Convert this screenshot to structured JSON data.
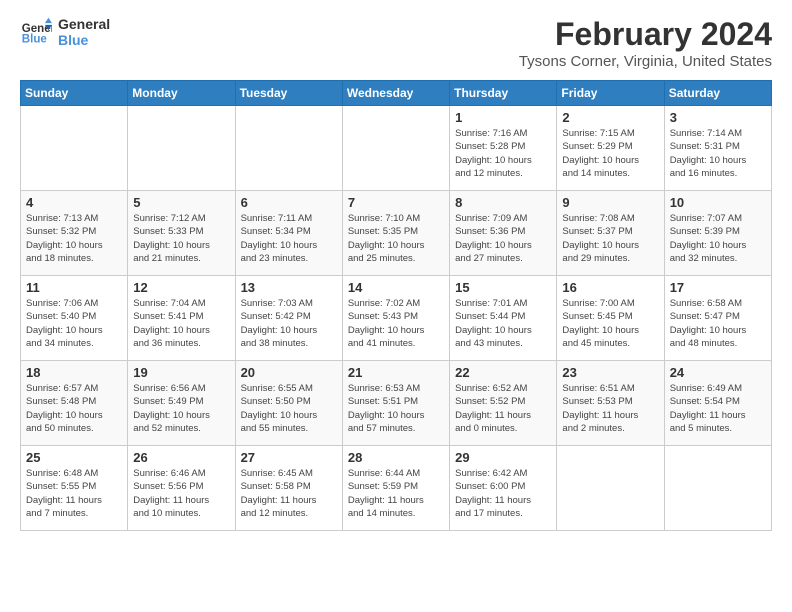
{
  "header": {
    "logo_line1": "General",
    "logo_line2": "Blue",
    "main_title": "February 2024",
    "subtitle": "Tysons Corner, Virginia, United States"
  },
  "weekdays": [
    "Sunday",
    "Monday",
    "Tuesday",
    "Wednesday",
    "Thursday",
    "Friday",
    "Saturday"
  ],
  "weeks": [
    [
      {
        "day": "",
        "info": ""
      },
      {
        "day": "",
        "info": ""
      },
      {
        "day": "",
        "info": ""
      },
      {
        "day": "",
        "info": ""
      },
      {
        "day": "1",
        "info": "Sunrise: 7:16 AM\nSunset: 5:28 PM\nDaylight: 10 hours\nand 12 minutes."
      },
      {
        "day": "2",
        "info": "Sunrise: 7:15 AM\nSunset: 5:29 PM\nDaylight: 10 hours\nand 14 minutes."
      },
      {
        "day": "3",
        "info": "Sunrise: 7:14 AM\nSunset: 5:31 PM\nDaylight: 10 hours\nand 16 minutes."
      }
    ],
    [
      {
        "day": "4",
        "info": "Sunrise: 7:13 AM\nSunset: 5:32 PM\nDaylight: 10 hours\nand 18 minutes."
      },
      {
        "day": "5",
        "info": "Sunrise: 7:12 AM\nSunset: 5:33 PM\nDaylight: 10 hours\nand 21 minutes."
      },
      {
        "day": "6",
        "info": "Sunrise: 7:11 AM\nSunset: 5:34 PM\nDaylight: 10 hours\nand 23 minutes."
      },
      {
        "day": "7",
        "info": "Sunrise: 7:10 AM\nSunset: 5:35 PM\nDaylight: 10 hours\nand 25 minutes."
      },
      {
        "day": "8",
        "info": "Sunrise: 7:09 AM\nSunset: 5:36 PM\nDaylight: 10 hours\nand 27 minutes."
      },
      {
        "day": "9",
        "info": "Sunrise: 7:08 AM\nSunset: 5:37 PM\nDaylight: 10 hours\nand 29 minutes."
      },
      {
        "day": "10",
        "info": "Sunrise: 7:07 AM\nSunset: 5:39 PM\nDaylight: 10 hours\nand 32 minutes."
      }
    ],
    [
      {
        "day": "11",
        "info": "Sunrise: 7:06 AM\nSunset: 5:40 PM\nDaylight: 10 hours\nand 34 minutes."
      },
      {
        "day": "12",
        "info": "Sunrise: 7:04 AM\nSunset: 5:41 PM\nDaylight: 10 hours\nand 36 minutes."
      },
      {
        "day": "13",
        "info": "Sunrise: 7:03 AM\nSunset: 5:42 PM\nDaylight: 10 hours\nand 38 minutes."
      },
      {
        "day": "14",
        "info": "Sunrise: 7:02 AM\nSunset: 5:43 PM\nDaylight: 10 hours\nand 41 minutes."
      },
      {
        "day": "15",
        "info": "Sunrise: 7:01 AM\nSunset: 5:44 PM\nDaylight: 10 hours\nand 43 minutes."
      },
      {
        "day": "16",
        "info": "Sunrise: 7:00 AM\nSunset: 5:45 PM\nDaylight: 10 hours\nand 45 minutes."
      },
      {
        "day": "17",
        "info": "Sunrise: 6:58 AM\nSunset: 5:47 PM\nDaylight: 10 hours\nand 48 minutes."
      }
    ],
    [
      {
        "day": "18",
        "info": "Sunrise: 6:57 AM\nSunset: 5:48 PM\nDaylight: 10 hours\nand 50 minutes."
      },
      {
        "day": "19",
        "info": "Sunrise: 6:56 AM\nSunset: 5:49 PM\nDaylight: 10 hours\nand 52 minutes."
      },
      {
        "day": "20",
        "info": "Sunrise: 6:55 AM\nSunset: 5:50 PM\nDaylight: 10 hours\nand 55 minutes."
      },
      {
        "day": "21",
        "info": "Sunrise: 6:53 AM\nSunset: 5:51 PM\nDaylight: 10 hours\nand 57 minutes."
      },
      {
        "day": "22",
        "info": "Sunrise: 6:52 AM\nSunset: 5:52 PM\nDaylight: 11 hours\nand 0 minutes."
      },
      {
        "day": "23",
        "info": "Sunrise: 6:51 AM\nSunset: 5:53 PM\nDaylight: 11 hours\nand 2 minutes."
      },
      {
        "day": "24",
        "info": "Sunrise: 6:49 AM\nSunset: 5:54 PM\nDaylight: 11 hours\nand 5 minutes."
      }
    ],
    [
      {
        "day": "25",
        "info": "Sunrise: 6:48 AM\nSunset: 5:55 PM\nDaylight: 11 hours\nand 7 minutes."
      },
      {
        "day": "26",
        "info": "Sunrise: 6:46 AM\nSunset: 5:56 PM\nDaylight: 11 hours\nand 10 minutes."
      },
      {
        "day": "27",
        "info": "Sunrise: 6:45 AM\nSunset: 5:58 PM\nDaylight: 11 hours\nand 12 minutes."
      },
      {
        "day": "28",
        "info": "Sunrise: 6:44 AM\nSunset: 5:59 PM\nDaylight: 11 hours\nand 14 minutes."
      },
      {
        "day": "29",
        "info": "Sunrise: 6:42 AM\nSunset: 6:00 PM\nDaylight: 11 hours\nand 17 minutes."
      },
      {
        "day": "",
        "info": ""
      },
      {
        "day": "",
        "info": ""
      }
    ]
  ]
}
